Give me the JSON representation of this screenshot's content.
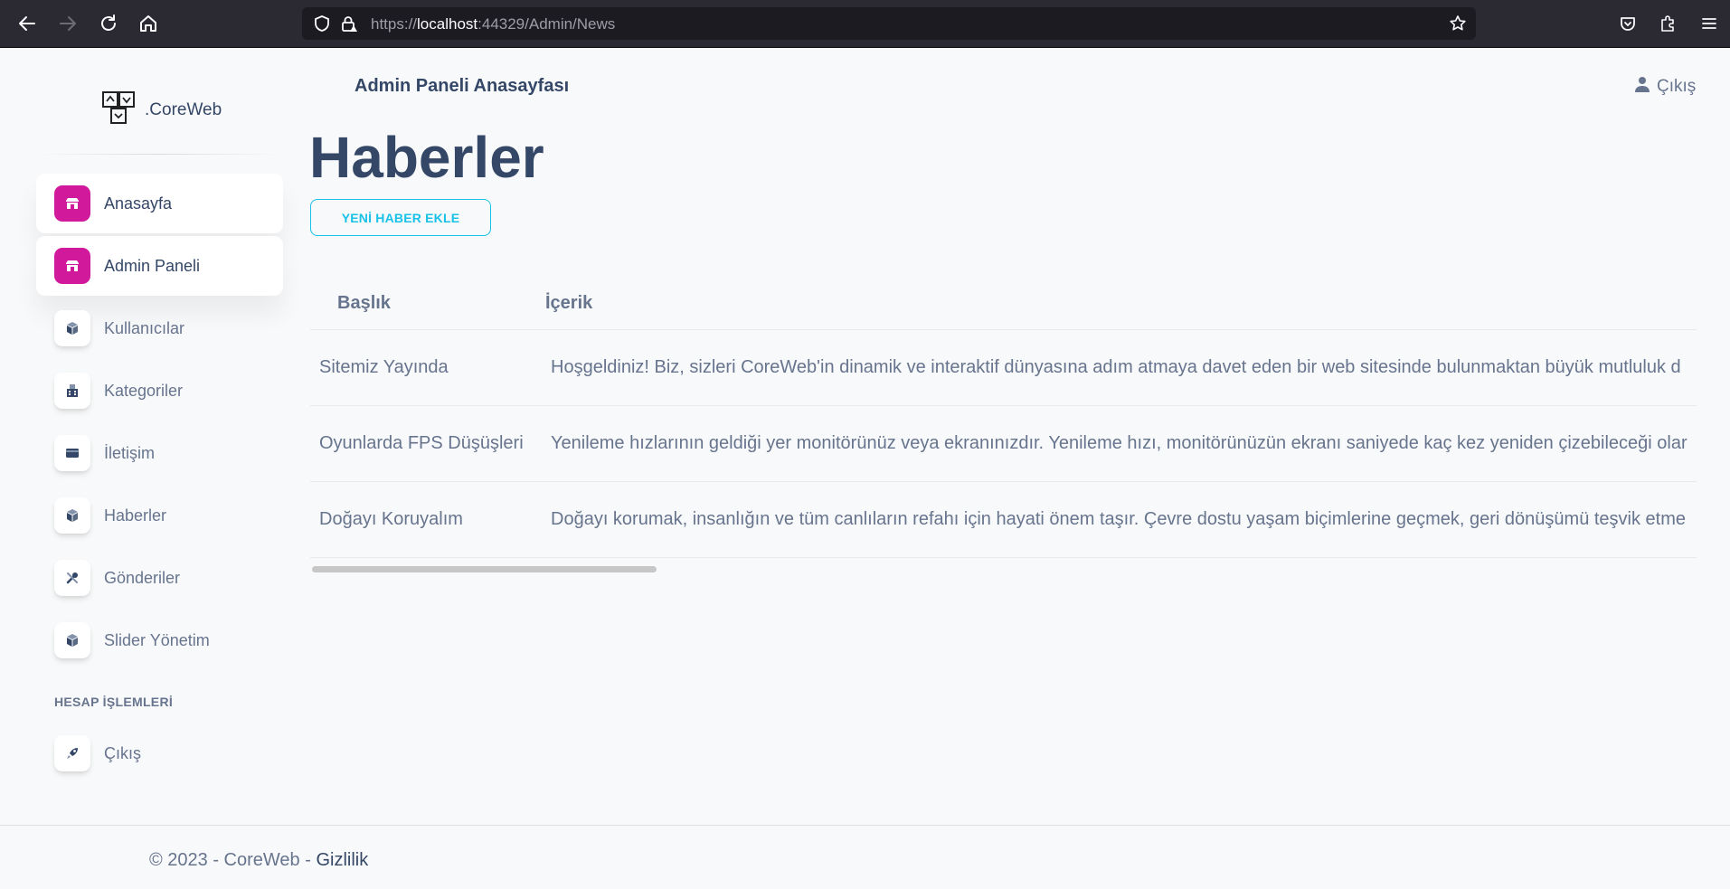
{
  "browser": {
    "url_prefix": "https://",
    "url_host": "localhost",
    "url_rest": ":44329/Admin/News"
  },
  "brand": {
    "name": ".CoreWeb"
  },
  "sidebar": {
    "items": [
      {
        "label": "Anasayfa",
        "icon": "shop-icon",
        "active": true
      },
      {
        "label": "Admin Paneli",
        "icon": "shop-icon",
        "active": true
      },
      {
        "label": "Kullanıcılar",
        "icon": "box-icon",
        "active": false
      },
      {
        "label": "Kategoriler",
        "icon": "office-icon",
        "active": false
      },
      {
        "label": "İletişim",
        "icon": "credit-card-icon",
        "active": false
      },
      {
        "label": "Haberler",
        "icon": "box-icon",
        "active": false
      },
      {
        "label": "Gönderiler",
        "icon": "settings-tools-icon",
        "active": false
      },
      {
        "label": "Slider Yönetim",
        "icon": "box-icon",
        "active": false
      }
    ],
    "section_title": "HESAP İŞLEMLERİ",
    "logout": {
      "label": "Çıkış",
      "icon": "spaceship-icon"
    }
  },
  "header": {
    "title": "Admin Paneli Anasayfası",
    "logout_label": "Çıkış"
  },
  "main": {
    "page_title": "Haberler",
    "add_button_label": "YENİ HABER EKLE",
    "table": {
      "headers": [
        "Başlık",
        "İçerik"
      ],
      "rows": [
        {
          "title": "Sitemiz Yayında",
          "content": "Hoşgeldiniz! Biz, sizleri CoreWeb'in dinamik ve interaktif dünyasına adım atmaya davet eden bir web sitesinde bulunmaktan büyük mutluluk d"
        },
        {
          "title": "Oyunlarda FPS Düşüşleri",
          "content": "Yenileme hızlarının geldiği yer monitörünüz veya ekranınızdır. Yenileme hızı, monitörünüzün ekranı saniyede kaç kez yeniden çizebileceği olar"
        },
        {
          "title": "Doğayı Koruyalım",
          "content": "Doğayı korumak, insanlığın ve tüm canlıların refahı için hayati önem taşır. Çevre dostu yaşam biçimlerine geçmek, geri dönüşümü teşvik etme"
        }
      ]
    }
  },
  "footer": {
    "copyright": "© 2023 - CoreWeb - ",
    "privacy_link": "Gizlilik"
  },
  "colors": {
    "accent_active": "#d11a9b",
    "primary_text": "#344767",
    "secondary_text": "#67748e",
    "info": "#17c1e8"
  }
}
